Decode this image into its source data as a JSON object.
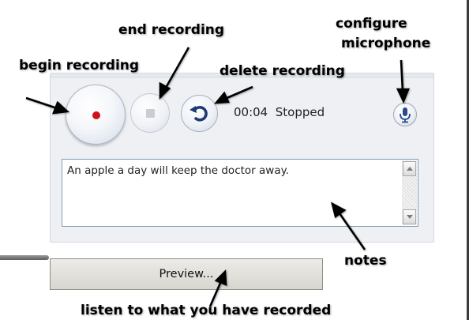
{
  "labels": {
    "end_recording": "end recording",
    "configure_microphone_line1": "configure",
    "configure_microphone_line2": "microphone",
    "begin_recording": "begin recording",
    "delete_recording": "delete recording",
    "notes": "notes",
    "listen": "listen to what you have recorded"
  },
  "recorder": {
    "time": "00:04",
    "status": "Stopped",
    "record_icon": "record-dot-icon",
    "stop_icon": "stop-square-icon",
    "delete_icon": "undo-arrow-icon",
    "mic_icon": "microphone-icon",
    "record_color": "#d0101c"
  },
  "notes_field": {
    "value": "An apple a day will keep the doctor away."
  },
  "preview_button": {
    "label": "Preview..."
  }
}
